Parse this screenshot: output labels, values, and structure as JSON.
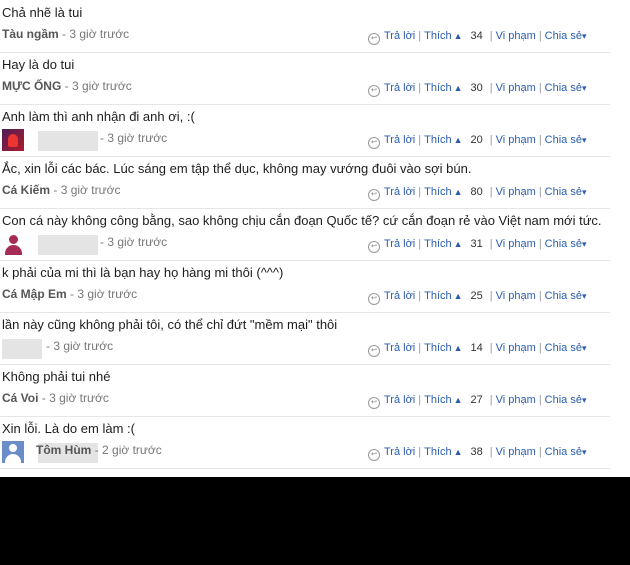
{
  "actions": {
    "reply": "Trả lời",
    "like": "Thích",
    "report": "Vi phạm",
    "share": "Chia sẻ"
  },
  "comments": [
    {
      "text": "Chả nhẽ là tui",
      "author": "Tàu ngầm",
      "time": "- 3 giờ trước",
      "likes": "34"
    },
    {
      "text": "Hay là do tui",
      "author": "MỰC ỐNG",
      "time": "- 3 giờ trước",
      "likes": "30"
    },
    {
      "text": "Anh làm thì anh nhận đi anh ơi, :(",
      "author": "",
      "time": "- 3 giờ trước",
      "likes": "20",
      "avatar": "red"
    },
    {
      "text": "Ắc, xin lỗi các bác. Lúc sáng em tập thể dục, không may vướng đuôi vào sợi bún.",
      "author": "Cá Kiếm",
      "time": "- 3 giờ trước",
      "likes": "80"
    },
    {
      "text": "Con cá này không công bằng, sao không chịu cắn đoạn Quốc tế? cứ cắn đoạn rẻ vào Việt nam mới tức.",
      "author": "",
      "time": "- 3 giờ trước",
      "likes": "31",
      "avatar": "person"
    },
    {
      "text": "k phải của mi thì là bạn hay họ hàng mi thôi (^^^)",
      "author": "Cá Mập Em",
      "time": "- 3 giờ trước",
      "likes": "25"
    },
    {
      "text": "lần này cũng không phải tôi, có thể chỉ đứt \"mềm mại\" thôi",
      "author": "",
      "time": "- 3 giờ trước",
      "likes": "14",
      "avatar": "blur"
    },
    {
      "text": "Không phải tui nhé",
      "author": "Cá Voi",
      "time": "- 3 giờ trước",
      "likes": "27"
    },
    {
      "text": "Xin lỗi. Là do em làm :(",
      "author": "Tôm Hùm",
      "time": "- 2 giờ trước",
      "likes": "38",
      "avatar": "blue"
    }
  ]
}
